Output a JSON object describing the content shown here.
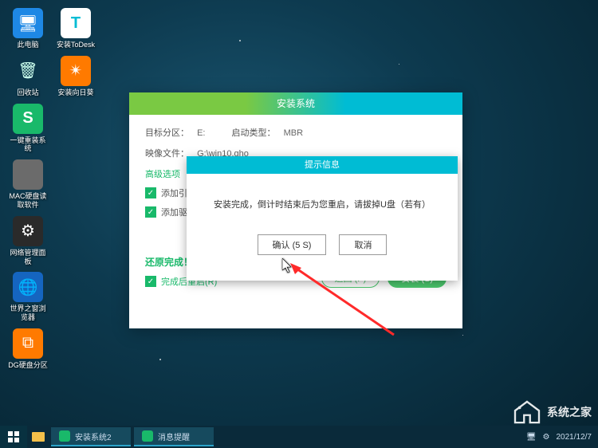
{
  "desktop": {
    "icons": [
      {
        "label": "此电脑",
        "color": "#1e88e5",
        "glyph": "🖥"
      },
      {
        "label": "安装ToDesk",
        "color": "#ffffff",
        "glyph": "T",
        "fg": "#00bcd4"
      },
      {
        "label": "回收站",
        "color": "transparent",
        "glyph": "🗑"
      },
      {
        "label": "安装向日葵",
        "color": "#ff7a00",
        "glyph": "✴"
      },
      {
        "label": "一键重装系统",
        "color": "#19b96a",
        "glyph": "S"
      },
      {
        "label": "MAC硬盘读取软件",
        "color": "#6b6b6b",
        "glyph": ""
      },
      {
        "label": "网络管理面板",
        "color": "#2a2a2a",
        "glyph": "⚙"
      },
      {
        "label": "世界之窗浏览器",
        "color": "#1565c0",
        "glyph": "🌐"
      },
      {
        "label": "DG硬盘分区",
        "color": "#ff7a00",
        "glyph": "⧉"
      }
    ]
  },
  "dialog": {
    "title": "安装系统",
    "target_label": "目标分区：",
    "target_value": "E:",
    "boot_label": "启动类型：",
    "boot_value": "MBR",
    "image_label": "映像文件：",
    "image_value": "G:\\win10.gho",
    "advanced": "高级选项",
    "chk1": "添加引导",
    "chk2": "添加驱动",
    "restore_done": "还原完成！",
    "restart_chk": "完成后重启(R)",
    "back_btn": "返回 (P)",
    "install_btn": "安装 (S)"
  },
  "inner": {
    "title": "提示信息",
    "message": "安装完成，倒计时结束后为您重启，请拔掉U盘（若有）",
    "ok": "确认 (5 S)",
    "cancel": "取消"
  },
  "taskbar": {
    "item1": "安装系统2",
    "item2": "消息提醒",
    "date": "2021/12/7"
  },
  "watermark": "系统之家"
}
